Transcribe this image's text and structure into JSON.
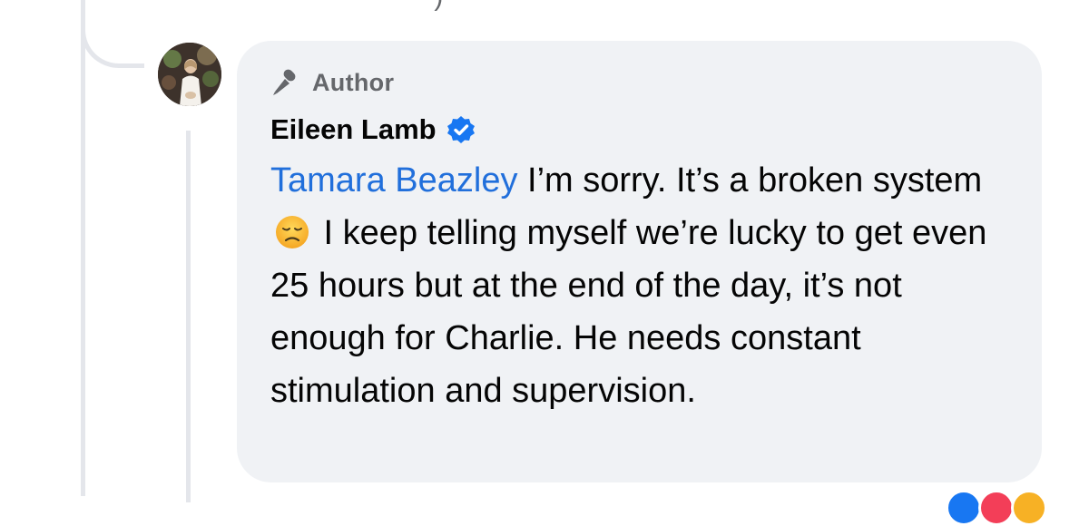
{
  "thread": {
    "previous_tail_text": "· ·)"
  },
  "comment": {
    "badge": {
      "icon": "microphone-icon",
      "label": "Author"
    },
    "author": {
      "name": "Eileen Lamb",
      "verified": true,
      "verified_color": "#1877f2"
    },
    "mention": "Tamara Beazley",
    "text_part_1": " I’m sorry. It’s a broken system ",
    "emoji": "disappointed-face-emoji",
    "text_part_2": " I keep telling myself we’re lucky to get even 25 hours but at the end of the day, it’s not enough for Charlie. He needs constant stimulation and supervision."
  },
  "reactions": [
    {
      "icon": "like-reaction-icon",
      "color": "#1877f2"
    },
    {
      "icon": "love-reaction-icon",
      "color": "#f33e58"
    },
    {
      "icon": "haha-reaction-icon",
      "color": "#f7b125"
    }
  ],
  "colors": {
    "bubble_bg": "#f0f2f5",
    "mention": "#216fdb",
    "meta_text": "#65676b",
    "thread_line": "#e4e6eb"
  }
}
